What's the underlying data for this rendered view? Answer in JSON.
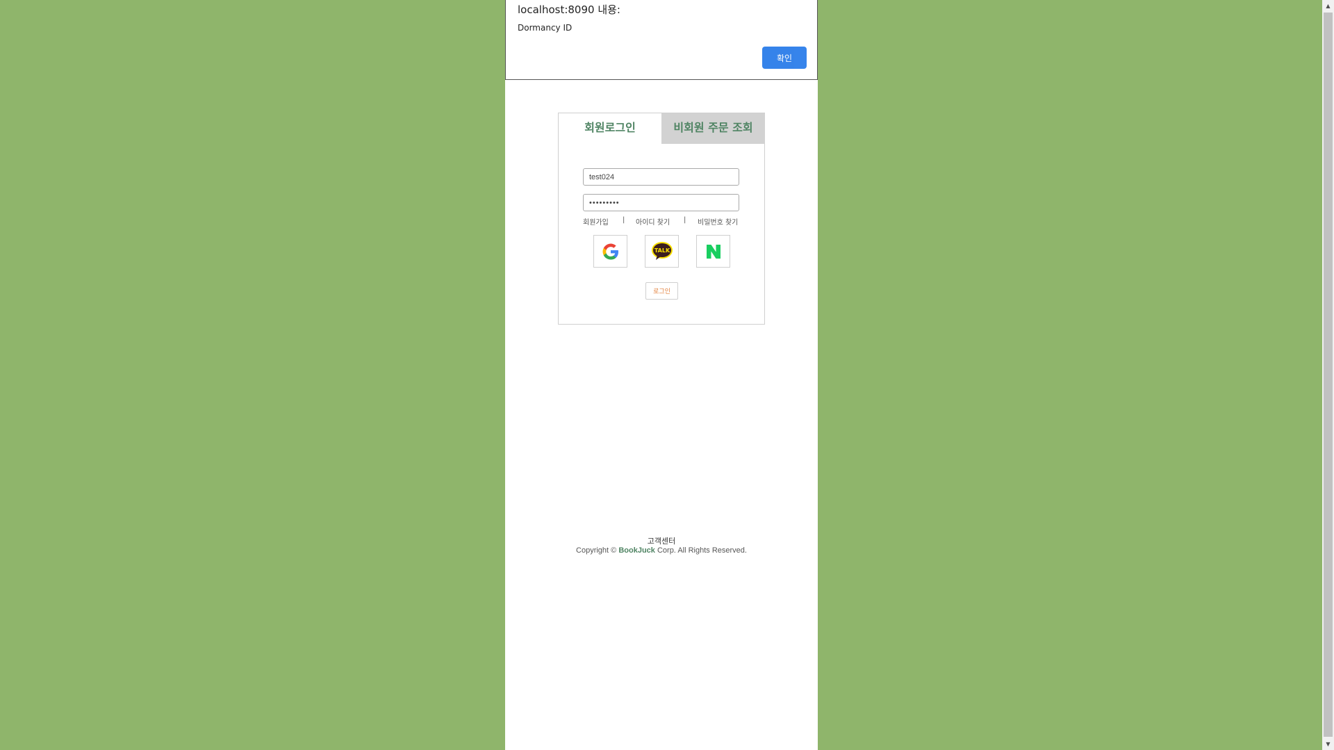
{
  "dialog": {
    "title": "localhost:8090 내용:",
    "message": "Dormancy ID",
    "ok_label": "확인"
  },
  "login": {
    "tabs": [
      {
        "label": "회원로그인",
        "active": true
      },
      {
        "label": "비회원 주문 조회",
        "active": false
      }
    ],
    "id_value": "test024",
    "password_value": "•••••••••",
    "links": [
      "회원가입",
      "|",
      "아이디 찾기",
      "|",
      "비밀번호 찾기"
    ],
    "social": [
      {
        "name": "google-icon",
        "label": "G"
      },
      {
        "name": "kakao-talk-icon",
        "label": "TALK"
      },
      {
        "name": "naver-icon",
        "label": "N"
      }
    ],
    "login_button": "로그인"
  },
  "footer": {
    "title": "고객센터",
    "copyright_prefix": "Copyright ©",
    "brand": "BookJuck",
    "copyright_suffix": "Corp. All Rights Reserved."
  },
  "colors": {
    "background": "#8fb56b",
    "brand_green": "#4f8463",
    "kakao_yellow": "#f9e000",
    "naver_green": "#03c75a",
    "dialog_button": "#1a73e8"
  }
}
